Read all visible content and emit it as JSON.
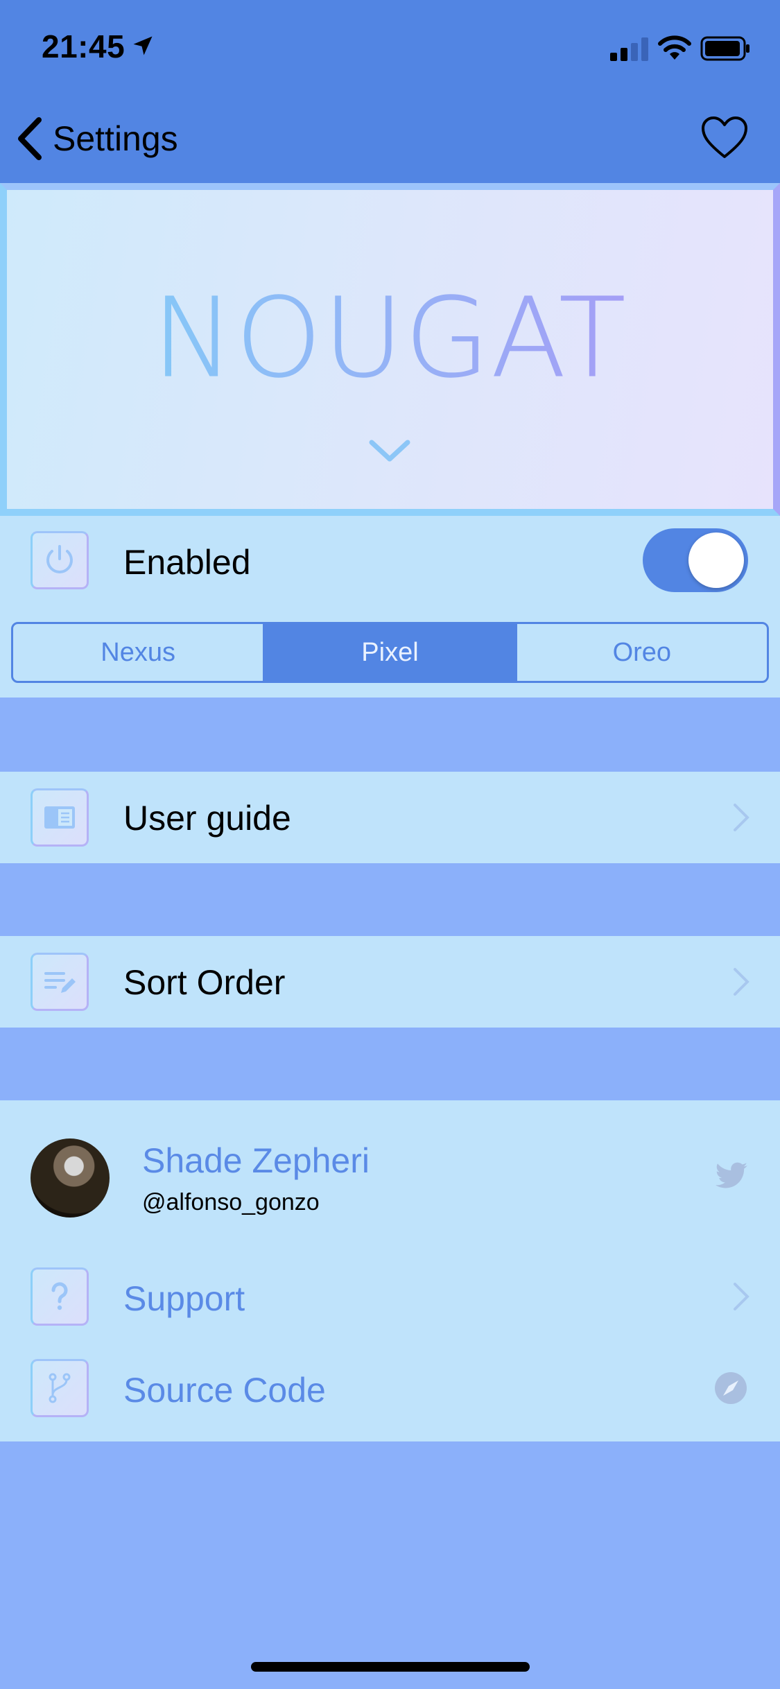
{
  "status_bar": {
    "time": "21:45",
    "icons": [
      "location-arrow-icon",
      "cellular-signal-icon",
      "wifi-icon",
      "battery-icon"
    ]
  },
  "nav": {
    "back_label": "Settings",
    "right_icon": "heart-icon"
  },
  "banner": {
    "title": "NOUGAT",
    "chevron_icon": "chevron-down-icon"
  },
  "enabled_row": {
    "icon": "power-icon",
    "label": "Enabled",
    "toggle_on": true
  },
  "style_selector": {
    "options": [
      "Nexus",
      "Pixel",
      "Oreo"
    ],
    "selected": "Pixel"
  },
  "menu": {
    "user_guide": {
      "icon": "book-icon",
      "label": "User guide"
    },
    "sort_order": {
      "icon": "edit-list-icon",
      "label": "Sort Order"
    }
  },
  "credits": {
    "author_name": "Shade Zepheri",
    "author_handle": "@alfonso_gonzo",
    "author_icon": "twitter-icon",
    "support": {
      "icon": "question-mark-icon",
      "label": "Support"
    },
    "source_code": {
      "icon": "branch-icon",
      "label": "Source Code",
      "right_icon": "compass-icon"
    }
  },
  "colors": {
    "accent": "#5285e3",
    "background": "#8bb0fa",
    "row_background": "#bfe3fb",
    "link_text": "#5a8ae6"
  }
}
